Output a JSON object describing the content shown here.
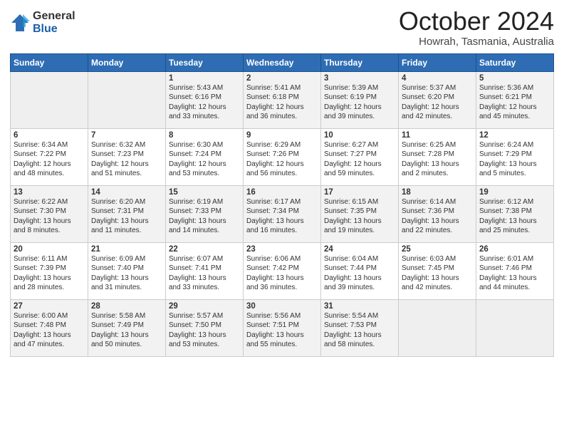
{
  "logo": {
    "general": "General",
    "blue": "Blue"
  },
  "header": {
    "title": "October 2024",
    "subtitle": "Howrah, Tasmania, Australia"
  },
  "weekdays": [
    "Sunday",
    "Monday",
    "Tuesday",
    "Wednesday",
    "Thursday",
    "Friday",
    "Saturday"
  ],
  "weeks": [
    [
      {
        "day": "",
        "info": ""
      },
      {
        "day": "",
        "info": ""
      },
      {
        "day": "1",
        "info": "Sunrise: 5:43 AM\nSunset: 6:16 PM\nDaylight: 12 hours and 33 minutes."
      },
      {
        "day": "2",
        "info": "Sunrise: 5:41 AM\nSunset: 6:18 PM\nDaylight: 12 hours and 36 minutes."
      },
      {
        "day": "3",
        "info": "Sunrise: 5:39 AM\nSunset: 6:19 PM\nDaylight: 12 hours and 39 minutes."
      },
      {
        "day": "4",
        "info": "Sunrise: 5:37 AM\nSunset: 6:20 PM\nDaylight: 12 hours and 42 minutes."
      },
      {
        "day": "5",
        "info": "Sunrise: 5:36 AM\nSunset: 6:21 PM\nDaylight: 12 hours and 45 minutes."
      }
    ],
    [
      {
        "day": "6",
        "info": "Sunrise: 6:34 AM\nSunset: 7:22 PM\nDaylight: 12 hours and 48 minutes."
      },
      {
        "day": "7",
        "info": "Sunrise: 6:32 AM\nSunset: 7:23 PM\nDaylight: 12 hours and 51 minutes."
      },
      {
        "day": "8",
        "info": "Sunrise: 6:30 AM\nSunset: 7:24 PM\nDaylight: 12 hours and 53 minutes."
      },
      {
        "day": "9",
        "info": "Sunrise: 6:29 AM\nSunset: 7:26 PM\nDaylight: 12 hours and 56 minutes."
      },
      {
        "day": "10",
        "info": "Sunrise: 6:27 AM\nSunset: 7:27 PM\nDaylight: 12 hours and 59 minutes."
      },
      {
        "day": "11",
        "info": "Sunrise: 6:25 AM\nSunset: 7:28 PM\nDaylight: 13 hours and 2 minutes."
      },
      {
        "day": "12",
        "info": "Sunrise: 6:24 AM\nSunset: 7:29 PM\nDaylight: 13 hours and 5 minutes."
      }
    ],
    [
      {
        "day": "13",
        "info": "Sunrise: 6:22 AM\nSunset: 7:30 PM\nDaylight: 13 hours and 8 minutes."
      },
      {
        "day": "14",
        "info": "Sunrise: 6:20 AM\nSunset: 7:31 PM\nDaylight: 13 hours and 11 minutes."
      },
      {
        "day": "15",
        "info": "Sunrise: 6:19 AM\nSunset: 7:33 PM\nDaylight: 13 hours and 14 minutes."
      },
      {
        "day": "16",
        "info": "Sunrise: 6:17 AM\nSunset: 7:34 PM\nDaylight: 13 hours and 16 minutes."
      },
      {
        "day": "17",
        "info": "Sunrise: 6:15 AM\nSunset: 7:35 PM\nDaylight: 13 hours and 19 minutes."
      },
      {
        "day": "18",
        "info": "Sunrise: 6:14 AM\nSunset: 7:36 PM\nDaylight: 13 hours and 22 minutes."
      },
      {
        "day": "19",
        "info": "Sunrise: 6:12 AM\nSunset: 7:38 PM\nDaylight: 13 hours and 25 minutes."
      }
    ],
    [
      {
        "day": "20",
        "info": "Sunrise: 6:11 AM\nSunset: 7:39 PM\nDaylight: 13 hours and 28 minutes."
      },
      {
        "day": "21",
        "info": "Sunrise: 6:09 AM\nSunset: 7:40 PM\nDaylight: 13 hours and 31 minutes."
      },
      {
        "day": "22",
        "info": "Sunrise: 6:07 AM\nSunset: 7:41 PM\nDaylight: 13 hours and 33 minutes."
      },
      {
        "day": "23",
        "info": "Sunrise: 6:06 AM\nSunset: 7:42 PM\nDaylight: 13 hours and 36 minutes."
      },
      {
        "day": "24",
        "info": "Sunrise: 6:04 AM\nSunset: 7:44 PM\nDaylight: 13 hours and 39 minutes."
      },
      {
        "day": "25",
        "info": "Sunrise: 6:03 AM\nSunset: 7:45 PM\nDaylight: 13 hours and 42 minutes."
      },
      {
        "day": "26",
        "info": "Sunrise: 6:01 AM\nSunset: 7:46 PM\nDaylight: 13 hours and 44 minutes."
      }
    ],
    [
      {
        "day": "27",
        "info": "Sunrise: 6:00 AM\nSunset: 7:48 PM\nDaylight: 13 hours and 47 minutes."
      },
      {
        "day": "28",
        "info": "Sunrise: 5:58 AM\nSunset: 7:49 PM\nDaylight: 13 hours and 50 minutes."
      },
      {
        "day": "29",
        "info": "Sunrise: 5:57 AM\nSunset: 7:50 PM\nDaylight: 13 hours and 53 minutes."
      },
      {
        "day": "30",
        "info": "Sunrise: 5:56 AM\nSunset: 7:51 PM\nDaylight: 13 hours and 55 minutes."
      },
      {
        "day": "31",
        "info": "Sunrise: 5:54 AM\nSunset: 7:53 PM\nDaylight: 13 hours and 58 minutes."
      },
      {
        "day": "",
        "info": ""
      },
      {
        "day": "",
        "info": ""
      }
    ]
  ]
}
